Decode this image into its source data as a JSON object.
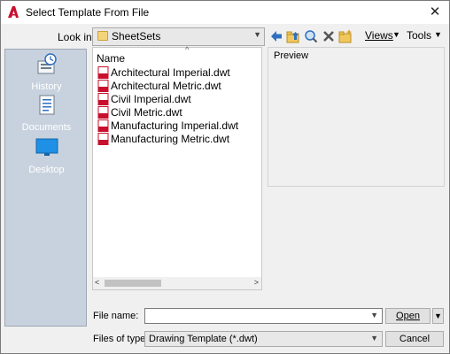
{
  "window": {
    "title": "Select Template From File",
    "close_glyph": "✕",
    "accent": "#c8102e"
  },
  "lookin": {
    "label": "Look in:",
    "value": "SheetSets"
  },
  "toolbar": {
    "views_label": "Views",
    "tools_label": "Tools",
    "icons": [
      "back-icon",
      "up-folder-icon",
      "search-web-icon",
      "delete-icon",
      "new-folder-icon"
    ]
  },
  "places": [
    {
      "label": "History",
      "icon": "history-icon"
    },
    {
      "label": "Documents",
      "icon": "documents-icon"
    },
    {
      "label": "Desktop",
      "icon": "desktop-icon"
    }
  ],
  "filelist": {
    "column_name": "Name",
    "files": [
      "Architectural Imperial.dwt",
      "Architectural Metric.dwt",
      "Civil Imperial.dwt",
      "Civil Metric.dwt",
      "Manufacturing Imperial.dwt",
      "Manufacturing Metric.dwt"
    ]
  },
  "preview": {
    "label": "Preview"
  },
  "filename": {
    "label": "File name:",
    "value": ""
  },
  "filetype": {
    "label": "Files of type:",
    "value": "Drawing Template (*.dwt)"
  },
  "buttons": {
    "open_label": "Open",
    "cancel_label": "Cancel"
  }
}
